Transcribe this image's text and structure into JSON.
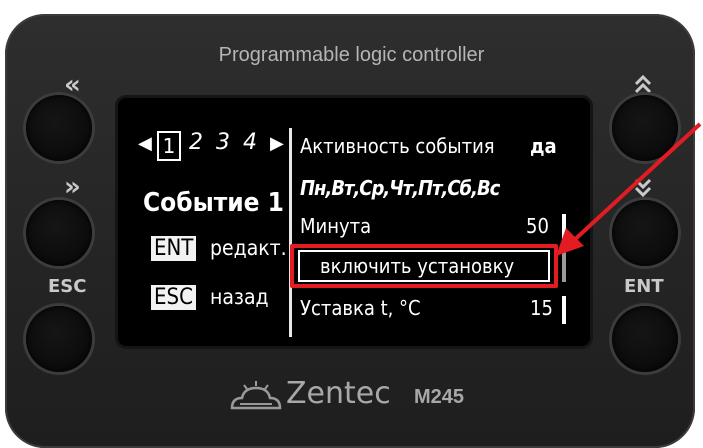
{
  "device": {
    "title": "Programmable logic controller",
    "brand": "Zentec",
    "model": "M245"
  },
  "buttons": {
    "left_top_label": "«",
    "left_mid_label": "»",
    "left_bottom_label": "ESC",
    "right_top_label": "⌃",
    "right_mid_label": "⌄",
    "right_bottom_label": "ENT"
  },
  "screen": {
    "tabs": {
      "prev_arrow": "◀",
      "active": "1",
      "others": [
        "2",
        "3",
        "4"
      ],
      "next_arrow": "▶"
    },
    "event_title": "Событие 1",
    "hints": [
      {
        "key": "ENT",
        "text": "редакт."
      },
      {
        "key": "ESC",
        "text": "назад"
      }
    ],
    "menu": {
      "activity_label": "Активность события",
      "activity_value": "да",
      "days": "Пн,Вт,Ср,Чт,Пт,Сб,Вс",
      "minute_label": "Минута",
      "minute_value": "50",
      "selected_item": "включить установку",
      "setpoint_label": "Уставка t, °C",
      "setpoint_value": "15"
    }
  },
  "colors": {
    "body": "#262626",
    "screen": "#000000",
    "annotation": "#e31b23"
  }
}
